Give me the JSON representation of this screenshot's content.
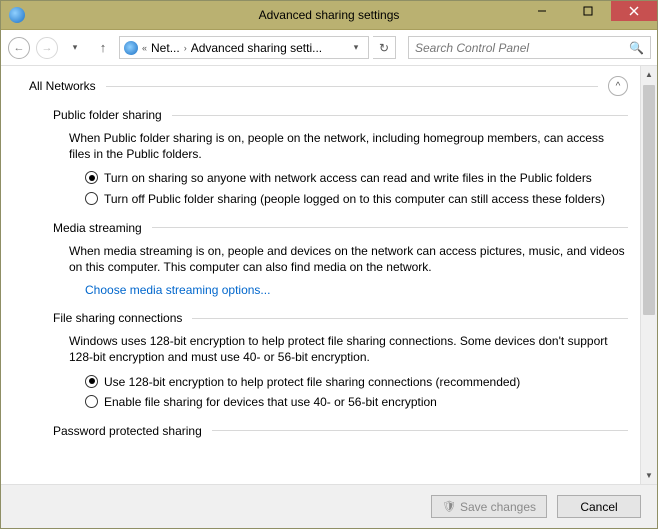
{
  "window": {
    "title": "Advanced sharing settings"
  },
  "nav": {
    "breadcrumb_1": "Net...",
    "breadcrumb_2": "Advanced sharing setti...",
    "search_placeholder": "Search Control Panel"
  },
  "profile": {
    "name": "All Networks"
  },
  "public_folder": {
    "heading": "Public folder sharing",
    "desc": "When Public folder sharing is on, people on the network, including homegroup members, can access files in the Public folders.",
    "opt_on": "Turn on sharing so anyone with network access can read and write files in the Public folders",
    "opt_off": "Turn off Public folder sharing (people logged on to this computer can still access these folders)",
    "selected": "on"
  },
  "media": {
    "heading": "Media streaming",
    "desc": "When media streaming is on, people and devices on the network can access pictures, music, and videos on this computer. This computer can also find media on the network.",
    "link": "Choose media streaming options..."
  },
  "encryption": {
    "heading": "File sharing connections",
    "desc": "Windows uses 128-bit encryption to help protect file sharing connections. Some devices don't support 128-bit encryption and must use 40- or 56-bit encryption.",
    "opt_128": "Use 128-bit encryption to help protect file sharing connections (recommended)",
    "opt_4056": "Enable file sharing for devices that use 40- or 56-bit encryption",
    "selected": "128"
  },
  "password_sharing": {
    "heading": "Password protected sharing"
  },
  "footer": {
    "save": "Save changes",
    "cancel": "Cancel"
  }
}
